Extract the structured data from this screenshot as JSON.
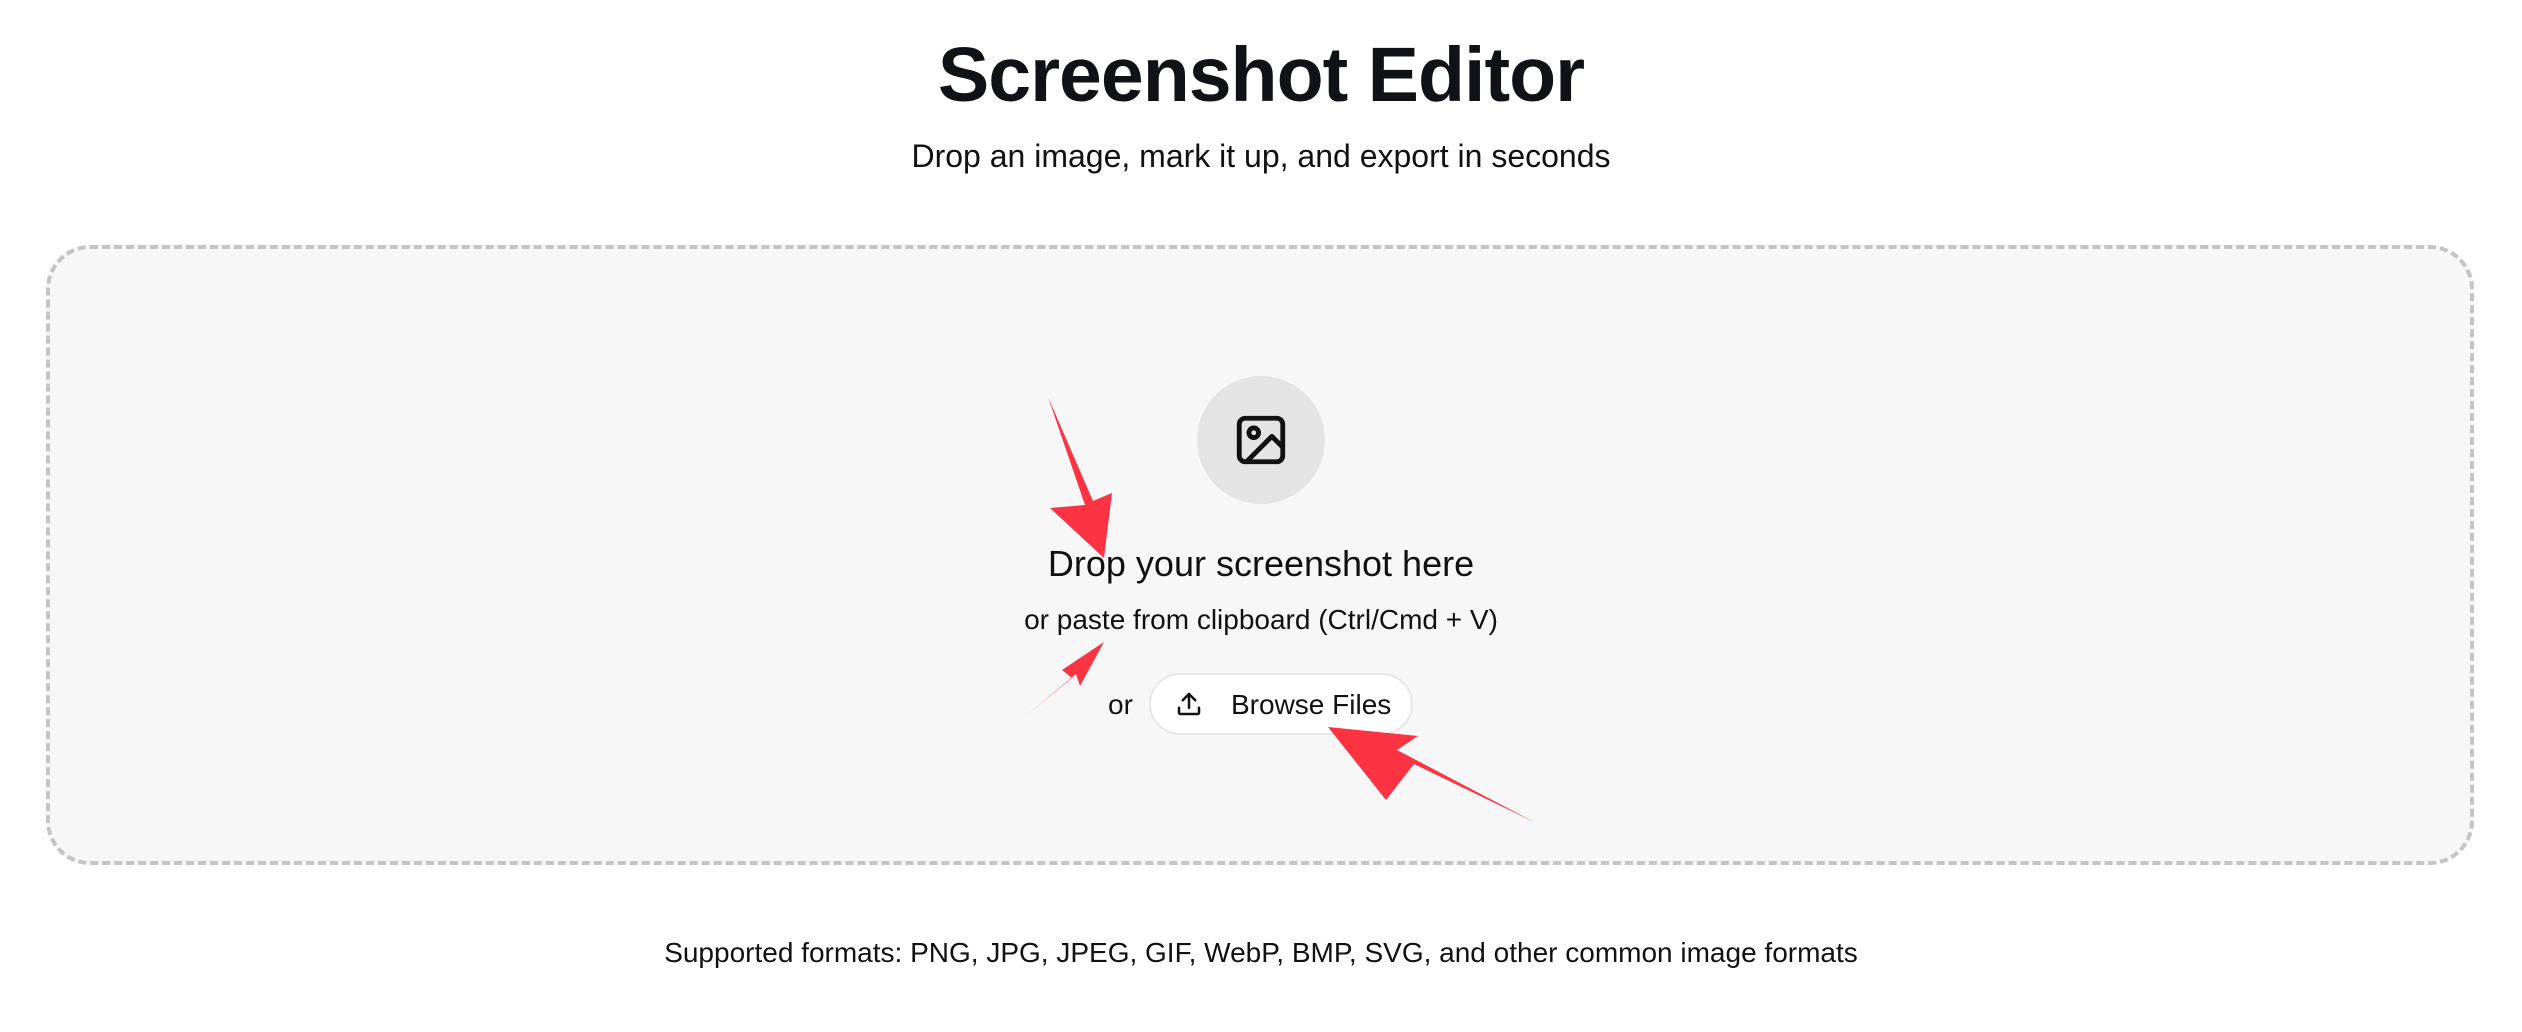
{
  "header": {
    "title": "Screenshot Editor",
    "subtitle": "Drop an image, mark it up, and export in seconds"
  },
  "dropzone": {
    "icon": "image-icon",
    "heading": "Drop your screenshot here",
    "paste_hint": "or paste from clipboard (Ctrl/Cmd + V)",
    "or_label": "or",
    "browse_button": {
      "icon": "upload-icon",
      "label": "Browse Files"
    }
  },
  "footer": {
    "supported_formats": "Supported formats: PNG, JPG, JPEG, GIF, WebP, BMP, SVG, and other common image formats"
  },
  "colors": {
    "annotation_arrow": "#fb3342",
    "dropzone_background": "#f7f7f7",
    "dropzone_border": "#c4c4c4",
    "icon_circle": "#e4e4e4"
  }
}
